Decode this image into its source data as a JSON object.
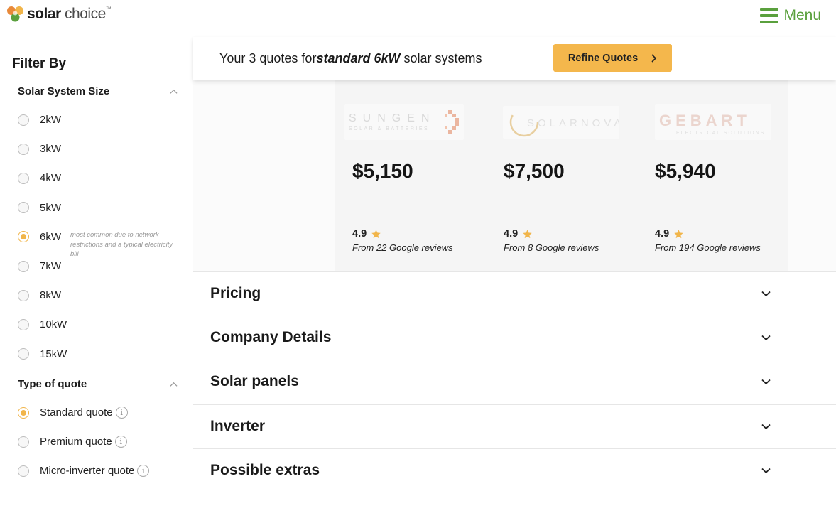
{
  "header": {
    "logo": {
      "solar": "solar",
      "choice": "choice",
      "tm": "™"
    },
    "menu_label": "Menu"
  },
  "sidebar": {
    "title": "Filter By",
    "size_section": {
      "title": "Solar System Size",
      "options": [
        "2kW",
        "3kW",
        "4kW",
        "5kW",
        "6kW",
        "7kW",
        "8kW",
        "10kW",
        "15kW"
      ],
      "selected": "6kW",
      "note": "most common due to network restrictions and a typical electricity bill"
    },
    "type_section": {
      "title": "Type of quote",
      "options": [
        "Standard quote",
        "Premium quote",
        "Micro-inverter quote"
      ],
      "selected": "Standard quote",
      "info_glyph": "i"
    }
  },
  "quote_bar": {
    "prefix": "Your 3 quotes for",
    "emphasis": "standard 6kW",
    "suffix": " solar systems",
    "refine_label": "Refine Quotes"
  },
  "cards": [
    {
      "price": "$5,150",
      "rating": "4.9",
      "reviews": "From 22 Google reviews"
    },
    {
      "price": "$7,500",
      "rating": "4.9",
      "reviews": "From 8 Google reviews"
    },
    {
      "price": "$5,940",
      "rating": "4.9",
      "reviews": "From 194 Google reviews"
    }
  ],
  "accordion": [
    "Pricing",
    "Company Details",
    "Solar panels",
    "Inverter",
    "Possible extras"
  ],
  "colors": {
    "accent_green": "#5aa03d",
    "accent_orange": "#f4b74c",
    "star": "#f1b54a"
  }
}
